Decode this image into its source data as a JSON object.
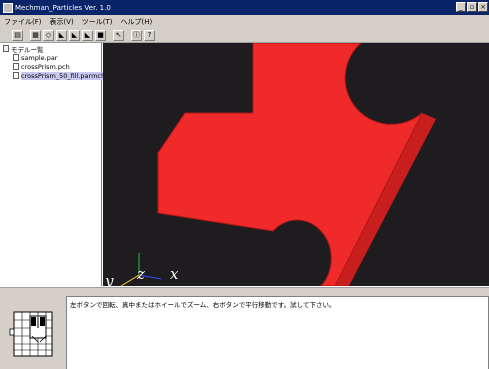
{
  "window": {
    "title": "Mechman_Particles  Ver. 1.0",
    "btn_minimize": "_",
    "btn_maximize": "▫",
    "btn_close": "×"
  },
  "menu": {
    "items": [
      {
        "label": "ファイル(F)"
      },
      {
        "label": "表示(V)"
      },
      {
        "label": "ツール(T)"
      },
      {
        "label": "ヘルプ(H)"
      }
    ]
  },
  "toolbar": {
    "buttons": [
      {
        "icon": "open-folder-icon",
        "glyph": "▤"
      },
      {
        "icon": "grid-icon",
        "glyph": "▦"
      },
      {
        "icon": "shape-icon",
        "glyph": "◇"
      },
      {
        "icon": "view-icon",
        "glyph": "◣"
      },
      {
        "icon": "view-icon",
        "glyph": "◣"
      },
      {
        "icon": "view-icon",
        "glyph": "◣"
      },
      {
        "icon": "fill-icon",
        "glyph": "■"
      },
      {
        "icon": "select-icon",
        "glyph": "↖"
      },
      {
        "icon": "info-icon",
        "glyph": "ⓘ"
      },
      {
        "icon": "help-icon",
        "glyph": "?"
      }
    ]
  },
  "tree": {
    "root": "モデル一覧",
    "files": [
      "sample.par",
      "crossPrism.pch",
      "crossPrism_50_fill.parmch"
    ],
    "selected_index": 2
  },
  "viewport": {
    "background": "#1e1c1e",
    "model_color": "#f02a2a",
    "model_edge": "#b01818",
    "axis_labels": {
      "x": "x",
      "y": "y",
      "z": "z"
    }
  },
  "status": {
    "message": "左ボタンで回転、真中またはホイールでズーム、右ボタンで平行移動です。試して下さい。"
  }
}
